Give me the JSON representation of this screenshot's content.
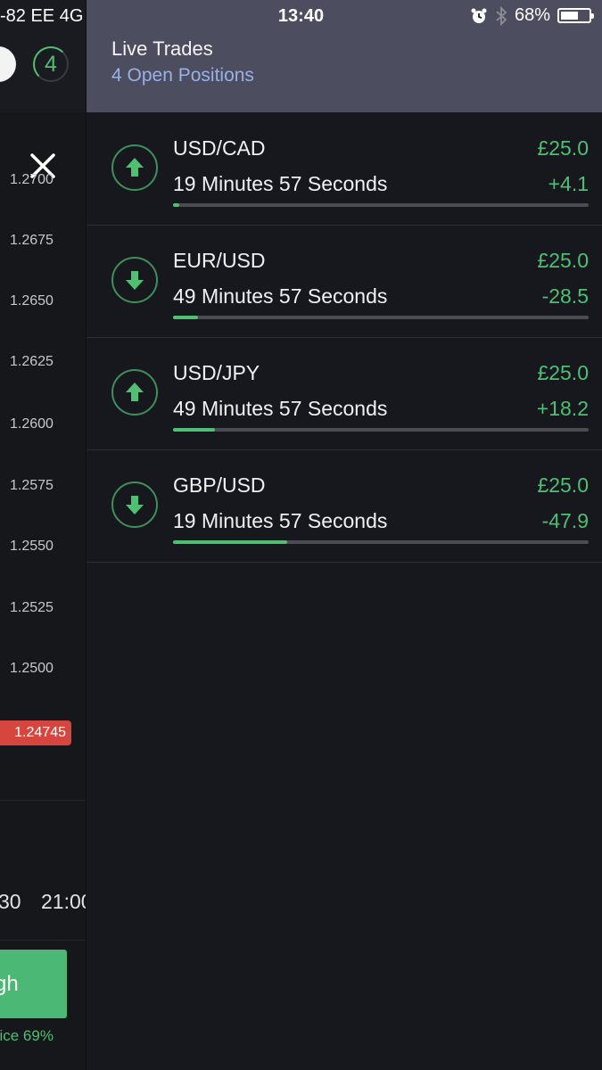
{
  "status_bar": {
    "carrier": "-82 EE  4G",
    "time": "13:40",
    "battery": "68%",
    "battery_level": 0.68,
    "icons": [
      "alarm-icon",
      "bluetooth-icon",
      "battery-icon"
    ]
  },
  "background_chart": {
    "open_count": "4",
    "price_labels": [
      "1.2700",
      "1.2675",
      "1.2650",
      "1.2625",
      "1.2600",
      "1.2575",
      "1.2550",
      "1.2525",
      "1.2500"
    ],
    "current_price": "1.24745",
    "time_labels": [
      "30",
      "21:00"
    ],
    "high_button": "gh",
    "payout": "oice 69%"
  },
  "drawer": {
    "title": "Live Trades",
    "subtitle": "4 Open Positions",
    "trades": [
      {
        "pair": "USD/CAD",
        "duration": "19 Minutes 57 Seconds",
        "stake": "£25.0",
        "pnl": "+4.1",
        "direction": "up",
        "progress": 0.015
      },
      {
        "pair": "EUR/USD",
        "duration": "49 Minutes 57 Seconds",
        "stake": "£25.0",
        "pnl": "-28.5",
        "direction": "down",
        "progress": 0.06
      },
      {
        "pair": "USD/JPY",
        "duration": "49 Minutes 57 Seconds",
        "stake": "£25.0",
        "pnl": "+18.2",
        "direction": "up",
        "progress": 0.1
      },
      {
        "pair": "GBP/USD",
        "duration": "19 Minutes 57 Seconds",
        "stake": "£25.0",
        "pnl": "-47.9",
        "direction": "down",
        "progress": 0.275
      }
    ]
  },
  "colors": {
    "accent_green": "#4fbf73",
    "price_red": "#d6463e",
    "header_bg": "#4c4d5e",
    "subtitle_blue": "#9bb0e6"
  }
}
